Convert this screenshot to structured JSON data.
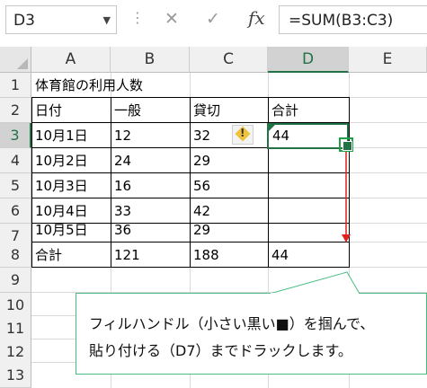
{
  "formula_bar": {
    "name_box": "D3",
    "cancel_icon": "✕",
    "enter_icon": "✓",
    "fx_label": "fx",
    "formula": "=SUM(B3:C3)"
  },
  "columns": [
    "A",
    "B",
    "C",
    "D",
    "E"
  ],
  "selected_column": "D",
  "rows": [
    "1",
    "2",
    "3",
    "4",
    "5",
    "6",
    "7",
    "8",
    "9",
    "10",
    "11",
    "12",
    "13"
  ],
  "selected_row": "3",
  "cells": {
    "A1": "体育館の利用人数",
    "A2": "日付",
    "B2": "一般",
    "C2": "貸切",
    "D2": "合計",
    "A3": "10月1日",
    "B3": "12",
    "C3": "32",
    "D3": "44",
    "A4": "10月2日",
    "B4": "24",
    "C4": "29",
    "A5": "10月3日",
    "B5": "16",
    "C5": "56",
    "A6": "10月4日",
    "B6": "33",
    "C6": "42",
    "A7": "10月5日",
    "B7": "36",
    "C7": "29",
    "A8": "合計",
    "B8": "121",
    "C8": "188",
    "D8": "44"
  },
  "warning_icon": "!",
  "callout": {
    "line1": "フィルハンドル（小さい黒い■）を掴んで、",
    "line2": "貼り付ける（D7）までドラックします。"
  },
  "colors": {
    "selection": "#217346",
    "arrow": "#e0201c",
    "callout_border": "#4cbc83"
  }
}
